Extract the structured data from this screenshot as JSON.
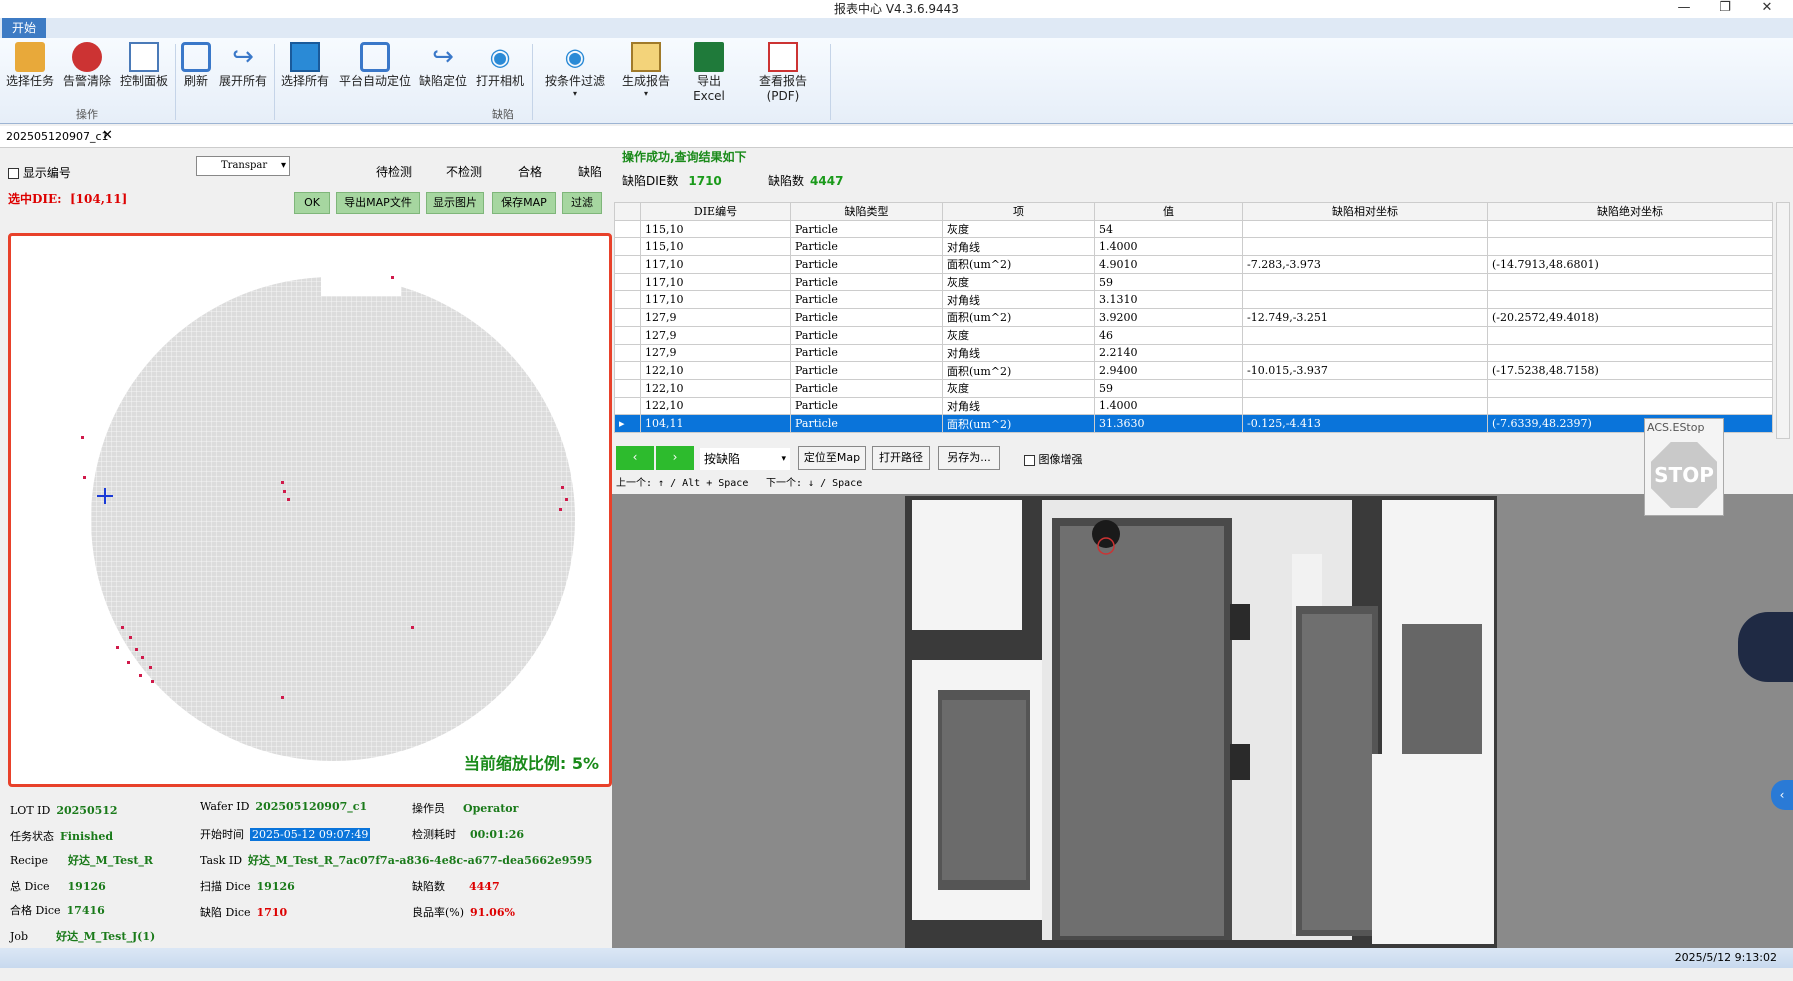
{
  "window": {
    "title": "报表中心 V4.3.6.9443"
  },
  "ribbon": {
    "tab": "开始",
    "buttons": [
      "选择任务",
      "告警清除",
      "控制面板",
      "刷新",
      "展开所有",
      "选择所有",
      "平台自动定位",
      "缺陷定位",
      "打开相机",
      "按条件过滤",
      "生成报告",
      "导出Excel",
      "查看报告(PDF)"
    ],
    "groups": [
      "操作",
      "缺陷"
    ]
  },
  "doc_tab": {
    "label": "202505120907_c1"
  },
  "left": {
    "show_id_label": "显示编号",
    "selected_die_label": "选中DIE:",
    "selected_die_value": "[104,11]",
    "dropdown_value": "Transpar",
    "legend": [
      "待检测",
      "不检测",
      "合格",
      "缺陷"
    ],
    "buttons": [
      "OK",
      "导出MAP文件",
      "显示图片",
      "保存MAP",
      "过滤"
    ],
    "zoom_text": "当前缩放比例: 5%"
  },
  "info": {
    "lot_id_label": "LOT ID",
    "lot_id": "20250512",
    "wafer_id_label": "Wafer ID",
    "wafer_id": "202505120907_c1",
    "operator_label": "操作员",
    "operator": "Operator",
    "task_state_label": "任务状态",
    "task_state": "Finished",
    "start_time_label": "开始时间",
    "start_time": "2025-05-12 09:07:49",
    "elapsed_label": "检测耗时",
    "elapsed": "00:01:26",
    "recipe_label": "Recipe",
    "recipe": "好达_M_Test_R",
    "task_id_label": "Task ID",
    "task_id": "好达_M_Test_R_7ac07f7a-a836-4e8c-a677-dea5662e9595",
    "total_dice_label": "总 Dice",
    "total_dice": "19126",
    "scan_dice_label": "扫描 Dice",
    "scan_dice": "19126",
    "defect_count_label": "缺陷数",
    "defect_count": "4447",
    "pass_dice_label": "合格 Dice",
    "pass_dice": "17416",
    "defect_dice_label": "缺陷 Dice",
    "defect_dice": "1710",
    "yield_label": "良品率(%)",
    "yield": "91.06%",
    "job_label": "Job",
    "job": "好达_M_Test_J(1)"
  },
  "right": {
    "status_msg": "操作成功,查询结果如下",
    "die_count_label": "缺陷DIE数",
    "die_count": "1710",
    "defect_count_label": "缺陷数",
    "defect_count": "4447",
    "columns": [
      "DIE编号",
      "缺陷类型",
      "项",
      "值",
      "缺陷相对坐标",
      "缺陷绝对坐标"
    ],
    "rows": [
      [
        "115,10",
        "Particle",
        "灰度",
        "54",
        "",
        ""
      ],
      [
        "115,10",
        "Particle",
        "对角线",
        "1.4000",
        "",
        ""
      ],
      [
        "117,10",
        "Particle",
        "面积(um^2)",
        "4.9010",
        "-7.283,-3.973",
        "(-14.7913,48.6801)"
      ],
      [
        "117,10",
        "Particle",
        "灰度",
        "59",
        "",
        ""
      ],
      [
        "117,10",
        "Particle",
        "对角线",
        "3.1310",
        "",
        ""
      ],
      [
        "127,9",
        "Particle",
        "面积(um^2)",
        "3.9200",
        "-12.749,-3.251",
        "(-20.2572,49.4018)"
      ],
      [
        "127,9",
        "Particle",
        "灰度",
        "46",
        "",
        ""
      ],
      [
        "127,9",
        "Particle",
        "对角线",
        "2.2140",
        "",
        ""
      ],
      [
        "122,10",
        "Particle",
        "面积(um^2)",
        "2.9400",
        "-10.015,-3.937",
        "(-17.5238,48.7158)"
      ],
      [
        "122,10",
        "Particle",
        "灰度",
        "59",
        "",
        ""
      ],
      [
        "122,10",
        "Particle",
        "对角线",
        "1.4000",
        "",
        ""
      ],
      [
        "104,11",
        "Particle",
        "面积(um^2)",
        "31.3630",
        "-0.125,-4.413",
        "(-7.6339,48.2397)"
      ]
    ],
    "nav": {
      "mode": "按缺陷",
      "locate": "定位至Map",
      "open_path": "打开路径",
      "save_as": "另存为...",
      "enhance": "图像增强",
      "prev_hint": "上一个: ↑ / Alt + Space",
      "next_hint": "下一个: ↓ / Space"
    },
    "stop_label": "ACS.EStop",
    "stop_text": "STOP"
  },
  "status": {
    "time": "2025/5/12 9:13:02"
  }
}
